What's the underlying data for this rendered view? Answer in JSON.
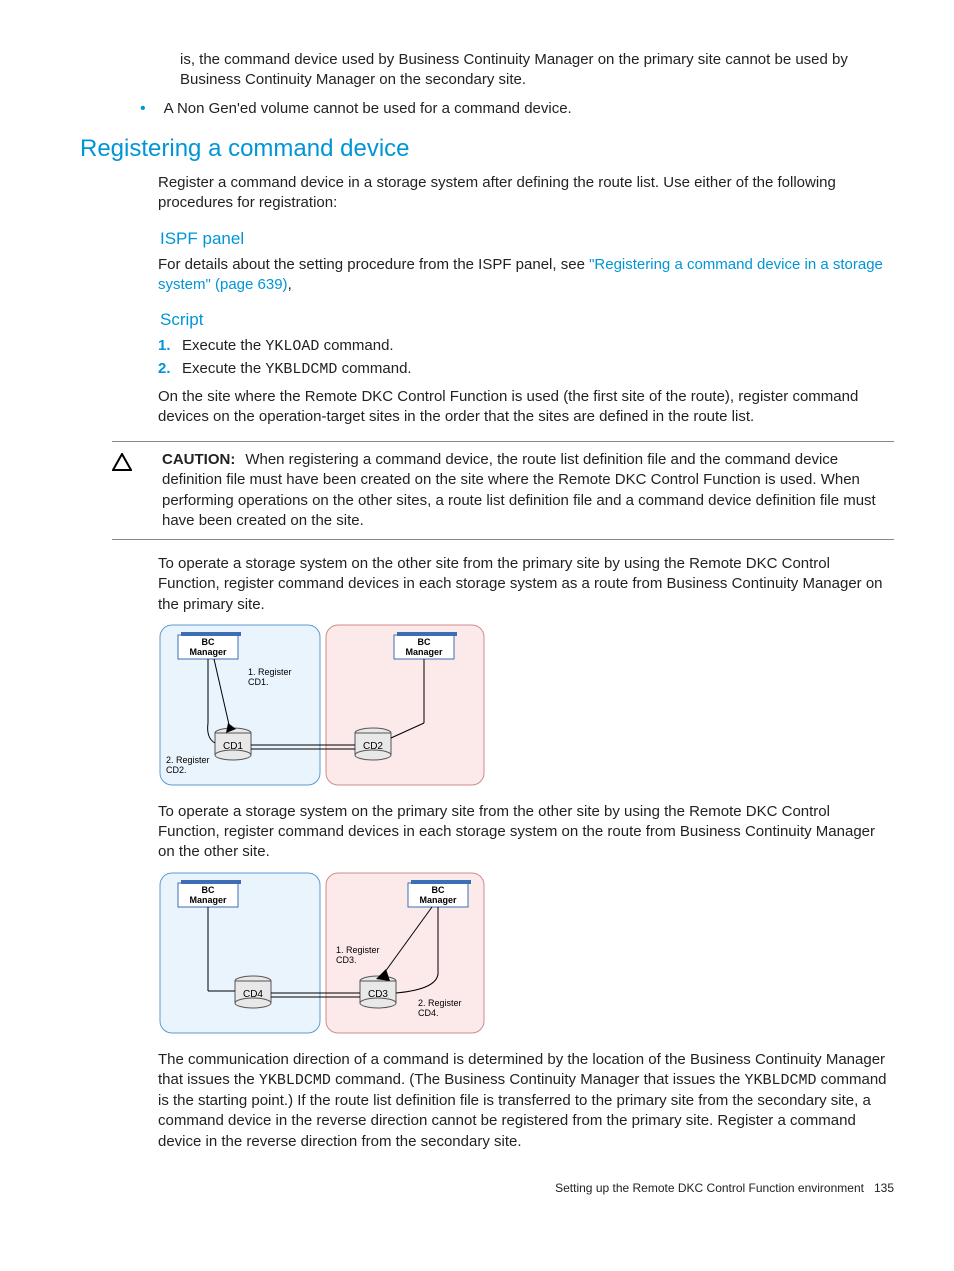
{
  "top_para": "is, the command device used by Business Continuity Manager on the primary site cannot be used by Business Continuity Manager on the secondary site.",
  "bullet1": "A Non Gen'ed volume cannot be used for a command device.",
  "h2": "Registering a command device",
  "reg_intro": "Register a command device in a storage system after defining the route list. Use either of the following procedures for registration:",
  "h3_ispf": "ISPF panel",
  "ispf_text_pre": "For details about the setting procedure from the ISPF panel, see ",
  "ispf_link": "\"Registering a command device in a storage system\" (page 639)",
  "ispf_text_post": ",",
  "h3_script": "Script",
  "step1_pre": "Execute the ",
  "step1_cmd": "YKLOAD",
  "step1_post": " command.",
  "step2_pre": "Execute the ",
  "step2_cmd": "YKBLDCMD",
  "step2_post": " command.",
  "script_para": "On the site where the Remote DKC Control Function is used (the first site of the route), register command devices on the operation-target sites in the order that the sites are defined in the route list.",
  "caution_label": "CAUTION:",
  "caution_text": "When registering a command device, the route list definition file and the command device definition file must have been created on the site where the Remote DKC Control Function is used. When performing operations on the other sites, a route list definition file and a command device definition file must have been created on the site.",
  "para_after_caution": "To operate a storage system on the other site from the primary site by using the Remote DKC Control Function, register command devices in each storage system as a route from Business Continuity Manager on the primary site.",
  "para_mid": "To operate a storage system on the primary site from the other site by using the Remote DKC Control Function, register command devices in each storage system on the route from Business Continuity Manager on the other site.",
  "last_para_pre": "The communication direction of a command is determined by the location of the Business Continuity Manager that issues the ",
  "last_para_cmd1": "YKBLDCMD",
  "last_para_mid1": " command. (The Business Continuity Manager that issues the ",
  "last_para_cmd2": "YKBLDCMD",
  "last_para_mid2": " command is the starting point.) If the route list definition file is transferred to the primary site from the secondary site, a command device in the reverse direction cannot be registered from the primary site. Register a command device in the reverse direction from the secondary site.",
  "footer_text": "Setting up the Remote DKC Control Function environment",
  "footer_page": "135",
  "diag": {
    "bc_manager": "BC\nManager",
    "reg_cd1": "1. Register\nCD1.",
    "reg_cd2": "2. Register\nCD2.",
    "reg_cd3": "1. Register\nCD3.",
    "reg_cd4": "2. Register\nCD4.",
    "cd1": "CD1",
    "cd2": "CD2",
    "cd3": "CD3",
    "cd4": "CD4"
  }
}
